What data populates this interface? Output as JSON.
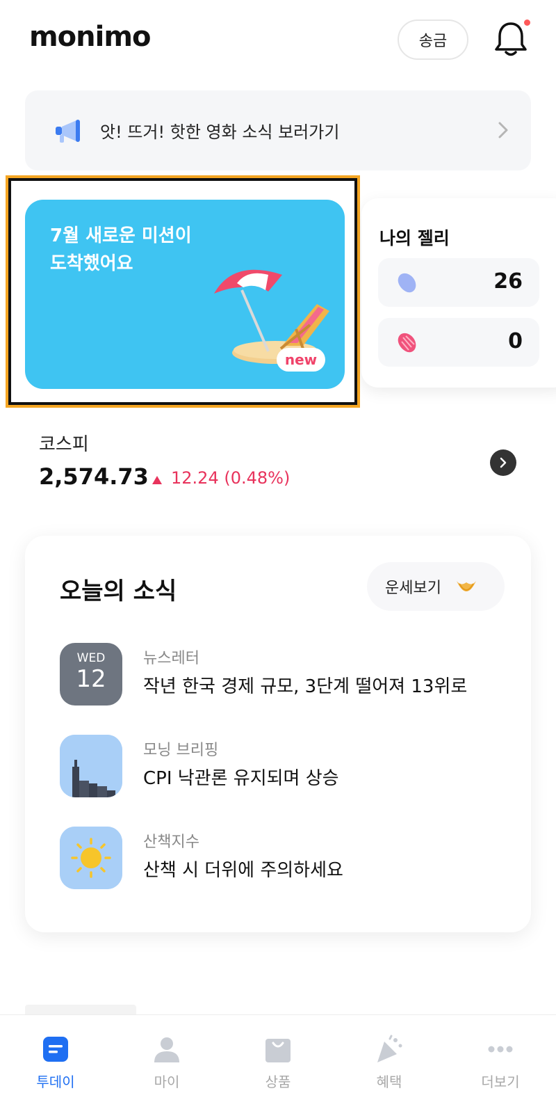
{
  "header": {
    "logo": "monimo",
    "send_label": "송금"
  },
  "notice": {
    "text": "앗! 뜨거! 핫한 영화 소식 보러가기"
  },
  "mission": {
    "title_line1": "7월 새로운 미션이",
    "title_line2": "도착했어요",
    "badge": "new"
  },
  "jelly": {
    "title": "나의 젤리",
    "blue_count": "26",
    "pink_count": "0"
  },
  "kospi": {
    "label": "코스피",
    "value": "2,574.73",
    "change": "12.24 (0.48%)",
    "direction": "up"
  },
  "news": {
    "heading": "오늘의 소식",
    "fortune_label": "운세보기",
    "items": [
      {
        "category": "뉴스레터",
        "title": "작년 한국 경제 규모, 3단계 떨어져 13위로",
        "day_of_week": "WED",
        "day": "12"
      },
      {
        "category": "모닝 브리핑",
        "title": "CPI 낙관론 유지되며 상승"
      },
      {
        "category": "산책지수",
        "title": "산책 시 더위에 주의하세요"
      }
    ]
  },
  "nav": {
    "items": [
      {
        "label": "투데이",
        "icon": "today-icon",
        "active": true
      },
      {
        "label": "마이",
        "icon": "person-icon",
        "active": false
      },
      {
        "label": "상품",
        "icon": "shopping-bag-icon",
        "active": false
      },
      {
        "label": "혜택",
        "icon": "party-popper-icon",
        "active": false
      },
      {
        "label": "더보기",
        "icon": "more-dots-icon",
        "active": false
      }
    ]
  },
  "colors": {
    "accent_blue": "#1f6ff2",
    "mission_bg": "#3fc4f2",
    "up_red": "#e8335c",
    "highlight": "#f5a623"
  }
}
